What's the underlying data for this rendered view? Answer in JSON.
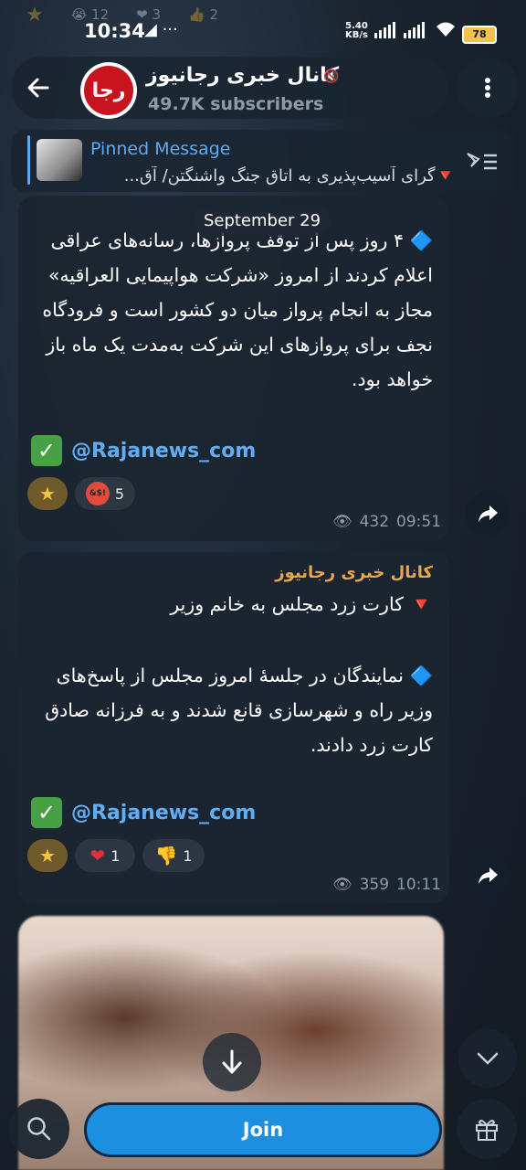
{
  "status_bar": {
    "time": "10:34",
    "left_icons": "◢ ···",
    "net_speed_value": "5.40",
    "net_speed_unit": "KB/s",
    "battery": "78"
  },
  "ghost_reactions": {
    "r1_count": "12",
    "r2_count": "3",
    "r3_count": "2"
  },
  "header": {
    "channel_name": "کانال خبری رجانیوز",
    "subscribers": "49.7K subscribers",
    "avatar_text": "رجا"
  },
  "pinned": {
    "title": "Pinned Message",
    "text": "🔻گرای آسیب‌پذیری به اتاق جنگ واشنگتن/ آق..."
  },
  "date_chip": "September 29",
  "message1": {
    "paragraph": "🔷 ۴ روز پس از توقف پروازها، رسانه‌های عراقی اعلام کردند از امروز «شرکت هواپیمایی العراقیه» مجاز به انجام پرواز میان دو کشور است و فرودگاه نجف برای پروازهای این شرکت به‌مدت یک ماه باز خواهد بود.",
    "handle": "@Rajanews_com",
    "reaction_angry_count": "5",
    "views": "432",
    "time": "09:51"
  },
  "message2": {
    "sender": "کانال خبری رجانیوز",
    "headline": "🔻 کارت زرد مجلس به خانم وزیر",
    "paragraph": "🔷 نمایندگان در جلسۀ امروز مجلس از پاسخ‌های وزیر راه و شهرسازی قانع شدند و به فرزانه صادق کارت زرد دادند.",
    "handle": "@Rajanews_com",
    "reaction_heart_count": "1",
    "reaction_dislike_count": "1",
    "views": "359",
    "time": "10:11"
  },
  "bottom": {
    "join_label": "Join"
  },
  "colors": {
    "accent": "#1d8fe0",
    "link": "#62acf2",
    "sender": "#e8a64a",
    "bubble": "#1b2531"
  }
}
